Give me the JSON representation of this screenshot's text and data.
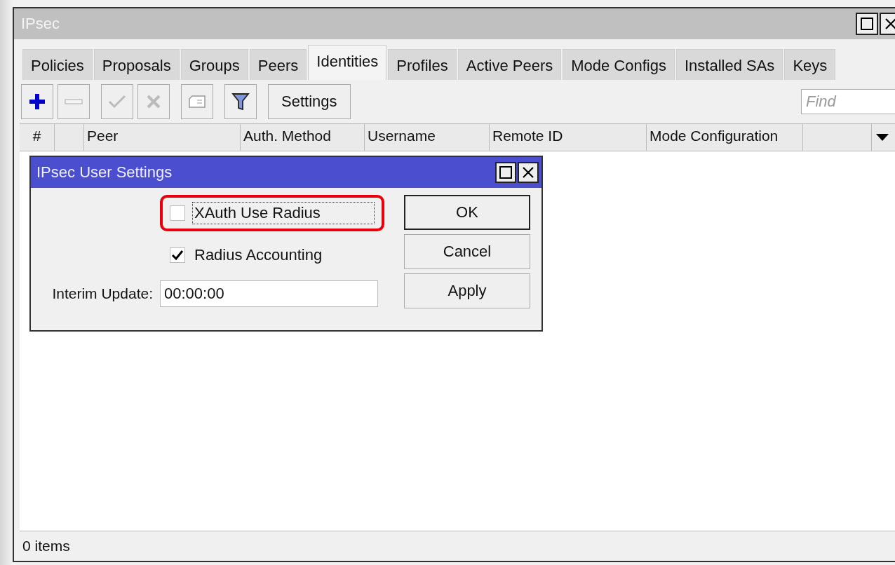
{
  "window": {
    "title": "IPsec"
  },
  "tabs": [
    {
      "label": "Policies",
      "selected": false
    },
    {
      "label": "Proposals",
      "selected": false
    },
    {
      "label": "Groups",
      "selected": false
    },
    {
      "label": "Peers",
      "selected": false
    },
    {
      "label": "Identities",
      "selected": true
    },
    {
      "label": "Profiles",
      "selected": false
    },
    {
      "label": "Active Peers",
      "selected": false
    },
    {
      "label": "Mode Configs",
      "selected": false
    },
    {
      "label": "Installed SAs",
      "selected": false
    },
    {
      "label": "Keys",
      "selected": false
    }
  ],
  "toolbar": {
    "buttons": [
      {
        "kind": "add",
        "disabled": false
      },
      {
        "kind": "remove",
        "disabled": true
      },
      {
        "kind": "enable",
        "disabled": true
      },
      {
        "kind": "disable",
        "disabled": true
      },
      {
        "kind": "comment",
        "disabled": true
      },
      {
        "kind": "filter",
        "disabled": false
      }
    ],
    "settings_button": "Settings",
    "search": {
      "placeholder": "Find"
    }
  },
  "table": {
    "columns": [
      {
        "label": "#"
      },
      {
        "kind": "blank"
      },
      {
        "label": "Peer"
      },
      {
        "label": "Auth. Method"
      },
      {
        "label": "Username"
      },
      {
        "label": "Remote ID"
      },
      {
        "label": "Mode Configuration"
      },
      {
        "kind": "blank"
      },
      {
        "kind": "menu"
      }
    ]
  },
  "status_bar": "0 items",
  "dialog": {
    "title": "IPsec User Settings",
    "checkboxes": [
      {
        "label": "XAuth Use Radius",
        "checked": false,
        "focused": true,
        "highlighted": true
      },
      {
        "label": "Radius Accounting",
        "checked": true,
        "focused": false,
        "highlighted": false
      }
    ],
    "field": {
      "label": "Interim Update:",
      "value": "00:00:00"
    },
    "buttons": [
      {
        "label": "OK",
        "default": true
      },
      {
        "label": "Cancel",
        "default": false
      },
      {
        "label": "Apply",
        "default": false
      }
    ]
  }
}
